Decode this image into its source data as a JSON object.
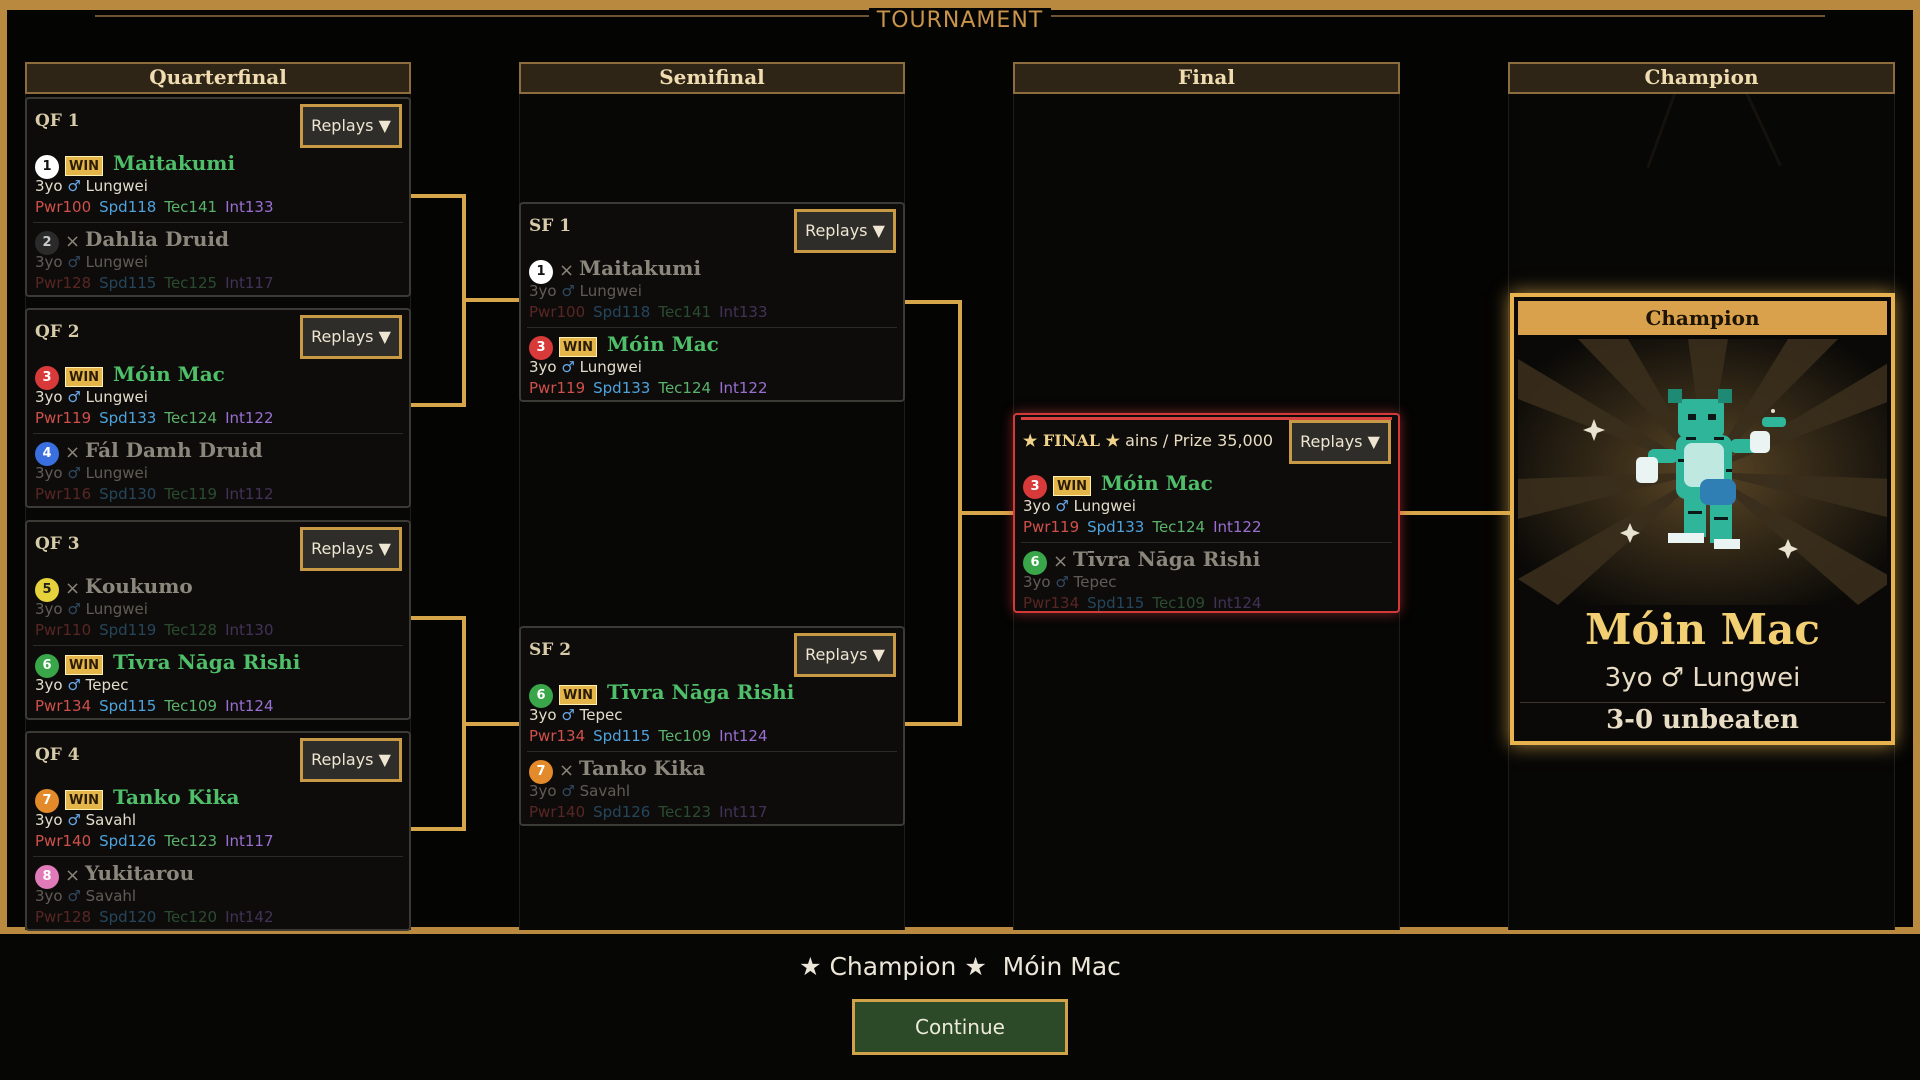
{
  "title": "TOURNAMENT",
  "columns": {
    "quarterfinal": "Quarterfinal",
    "semifinal": "Semifinal",
    "final": "Final",
    "champion": "Champion"
  },
  "replays_label": "Replays",
  "win_label": "WIN",
  "loss_mark": "×",
  "colors": {
    "gold": "#d7a64a",
    "win_green": "#4fbf6a",
    "final_red": "#d23a3a",
    "panel": "#0d0c0b"
  },
  "matches": [
    {
      "code": "QF 1",
      "entries": [
        {
          "seed": "1",
          "seed_color": "#ffffff",
          "seed_text": "#111111",
          "result": "win",
          "name": "Maitakumi",
          "age": "3yo",
          "gender": "♂",
          "breed": "Lungwei",
          "pwr": "Pwr100",
          "spd": "Spd118",
          "tec": "Tec141",
          "int": "Int133"
        },
        {
          "seed": "2",
          "seed_color": "#2a2a2a",
          "seed_text": "#cccccc",
          "result": "loss",
          "name": "Dahlia Druid",
          "age": "3yo",
          "gender": "♂",
          "breed": "Lungwei",
          "pwr": "Pwr128",
          "spd": "Spd115",
          "tec": "Tec125",
          "int": "Int117"
        }
      ]
    },
    {
      "code": "QF 2",
      "entries": [
        {
          "seed": "3",
          "seed_color": "#d83a3a",
          "seed_text": "#ffffff",
          "result": "win",
          "name": "Móin Mac",
          "age": "3yo",
          "gender": "♂",
          "breed": "Lungwei",
          "pwr": "Pwr119",
          "spd": "Spd133",
          "tec": "Tec124",
          "int": "Int122"
        },
        {
          "seed": "4",
          "seed_color": "#3a6fe0",
          "seed_text": "#ffffff",
          "result": "loss",
          "name": "Fál Damh Druid",
          "age": "3yo",
          "gender": "♂",
          "breed": "Lungwei",
          "pwr": "Pwr116",
          "spd": "Spd130",
          "tec": "Tec119",
          "int": "Int112"
        }
      ]
    },
    {
      "code": "QF 3",
      "entries": [
        {
          "seed": "5",
          "seed_color": "#e6d23a",
          "seed_text": "#222222",
          "result": "loss",
          "name": "Koukumo",
          "age": "3yo",
          "gender": "♂",
          "breed": "Lungwei",
          "pwr": "Pwr110",
          "spd": "Spd119",
          "tec": "Tec128",
          "int": "Int130"
        },
        {
          "seed": "6",
          "seed_color": "#3aa64a",
          "seed_text": "#ffffff",
          "result": "win",
          "name": "Tīvra Nāga Rishi",
          "age": "3yo",
          "gender": "♂",
          "breed": "Tepec",
          "pwr": "Pwr134",
          "spd": "Spd115",
          "tec": "Tec109",
          "int": "Int124"
        }
      ]
    },
    {
      "code": "QF 4",
      "entries": [
        {
          "seed": "7",
          "seed_color": "#e38a2a",
          "seed_text": "#ffffff",
          "result": "win",
          "name": "Tanko Kika",
          "age": "3yo",
          "gender": "♂",
          "breed": "Savahl",
          "pwr": "Pwr140",
          "spd": "Spd126",
          "tec": "Tec123",
          "int": "Int117"
        },
        {
          "seed": "8",
          "seed_color": "#e07ab8",
          "seed_text": "#ffffff",
          "result": "loss",
          "name": "Yukitarou",
          "age": "3yo",
          "gender": "♂",
          "breed": "Savahl",
          "pwr": "Pwr128",
          "spd": "Spd120",
          "tec": "Tec120",
          "int": "Int142"
        }
      ]
    },
    {
      "code": "SF 1",
      "entries": [
        {
          "seed": "1",
          "seed_color": "#ffffff",
          "seed_text": "#111111",
          "result": "loss",
          "name": "Maitakumi",
          "age": "3yo",
          "gender": "♂",
          "breed": "Lungwei",
          "pwr": "Pwr100",
          "spd": "Spd118",
          "tec": "Tec141",
          "int": "Int133"
        },
        {
          "seed": "3",
          "seed_color": "#d83a3a",
          "seed_text": "#ffffff",
          "result": "win",
          "name": "Móin Mac",
          "age": "3yo",
          "gender": "♂",
          "breed": "Lungwei",
          "pwr": "Pwr119",
          "spd": "Spd133",
          "tec": "Tec124",
          "int": "Int122"
        }
      ]
    },
    {
      "code": "SF 2",
      "entries": [
        {
          "seed": "6",
          "seed_color": "#3aa64a",
          "seed_text": "#ffffff",
          "result": "win",
          "name": "Tīvra Nāga Rishi",
          "age": "3yo",
          "gender": "♂",
          "breed": "Tepec",
          "pwr": "Pwr134",
          "spd": "Spd115",
          "tec": "Tec109",
          "int": "Int124"
        },
        {
          "seed": "7",
          "seed_color": "#e38a2a",
          "seed_text": "#ffffff",
          "result": "loss",
          "name": "Tanko Kika",
          "age": "3yo",
          "gender": "♂",
          "breed": "Savahl",
          "pwr": "Pwr140",
          "spd": "Spd126",
          "tec": "Tec123",
          "int": "Int117"
        }
      ]
    },
    {
      "code": "FINAL",
      "entries": [
        {
          "seed": "3",
          "seed_color": "#d83a3a",
          "seed_text": "#ffffff",
          "result": "win",
          "name": "Móin Mac",
          "age": "3yo",
          "gender": "♂",
          "breed": "Lungwei",
          "pwr": "Pwr119",
          "spd": "Spd133",
          "tec": "Tec124",
          "int": "Int122"
        },
        {
          "seed": "6",
          "seed_color": "#3aa64a",
          "seed_text": "#ffffff",
          "result": "loss",
          "name": "Tīvra Nāga Rishi",
          "age": "3yo",
          "gender": "♂",
          "breed": "Tepec",
          "pwr": "Pwr134",
          "spd": "Spd115",
          "tec": "Tec109",
          "int": "Int124"
        }
      ]
    }
  ],
  "final": {
    "star": "★",
    "label": "FINAL",
    "subtitle": "ains",
    "separator": "/",
    "prize": "Prize 35,000"
  },
  "champion": {
    "label": "Champion",
    "name": "Móin Mac",
    "subtitle": "3yo ♂ Lungwei",
    "record": "3-0 unbeaten"
  },
  "announcement": {
    "star": "★",
    "label": "Champion",
    "name": "Móin Mac"
  },
  "continue_label": "Continue"
}
